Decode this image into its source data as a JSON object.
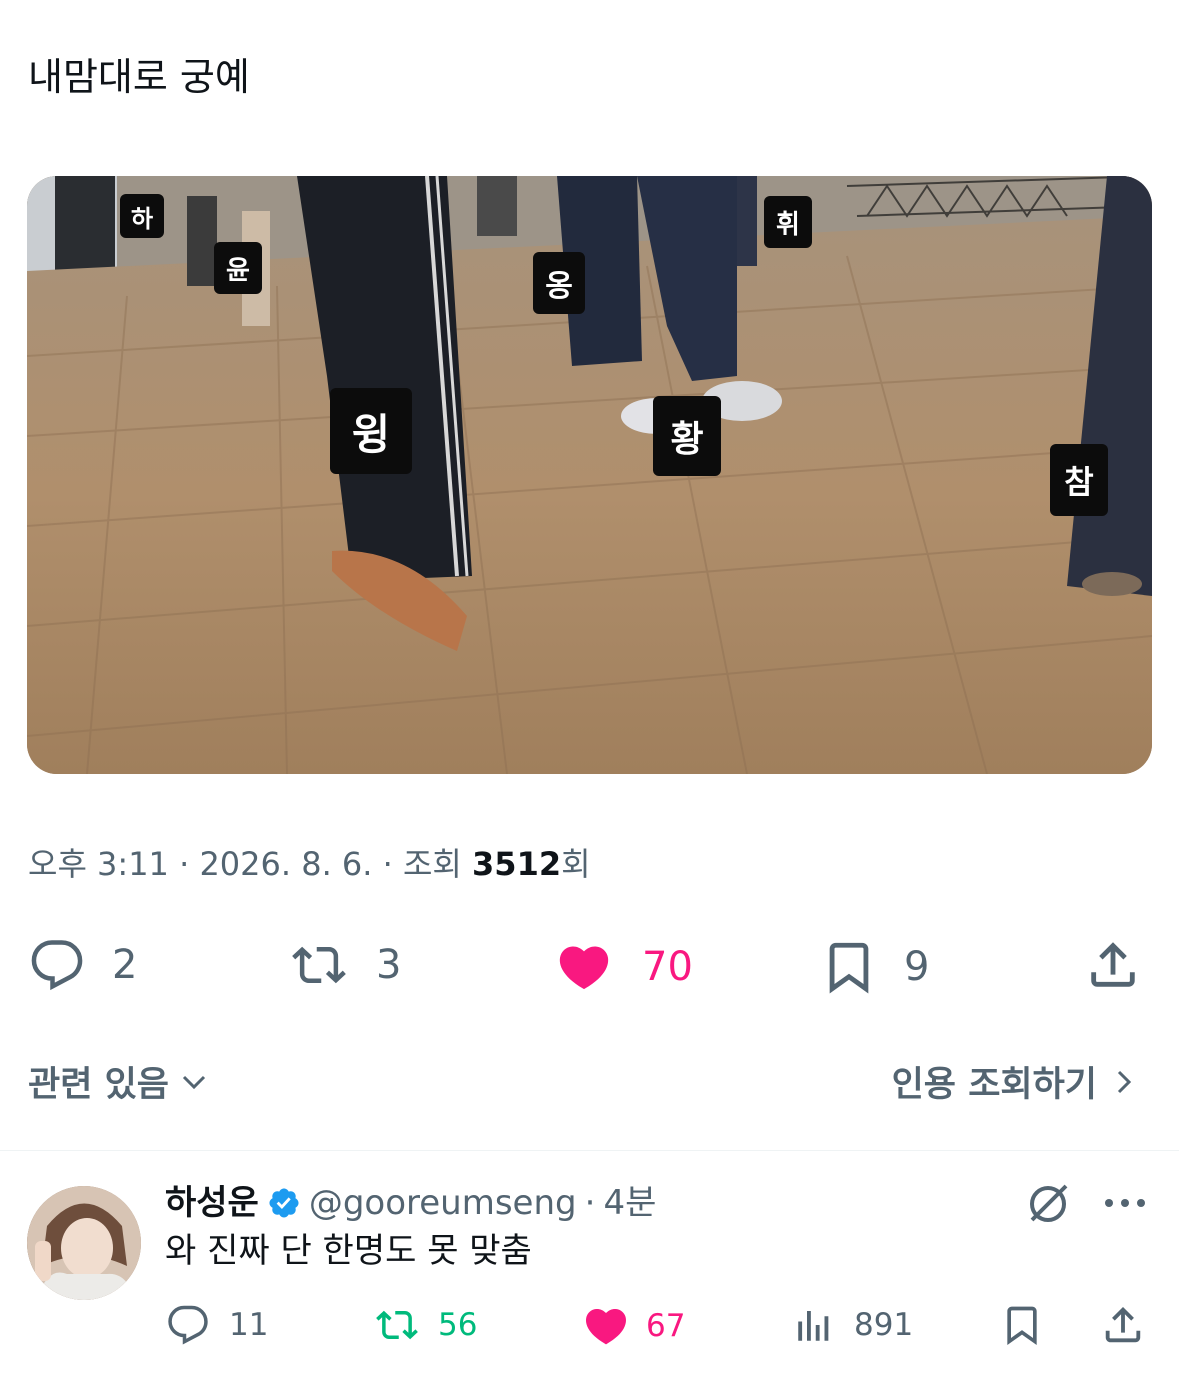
{
  "tweet": {
    "text": "내맘대로 궁예",
    "media_tags": [
      "하",
      "윤",
      "옹",
      "휘",
      "윙",
      "황",
      "참"
    ],
    "meta": {
      "time": "오후 3:11",
      "sep1": " · ",
      "date": "2026. 8. 6.",
      "sep2": " · ",
      "views_prefix": "조회 ",
      "views": "3512",
      "views_suffix": "회"
    },
    "actions": {
      "replies": "2",
      "retweets": "3",
      "likes": "70",
      "bookmarks": "9"
    },
    "colors": {
      "like": "#f91880",
      "muted": "#536471",
      "verified": "#1d9bf0",
      "retweet": "#00ba7c"
    }
  },
  "related": {
    "label": "관련 있음",
    "quotes_label": "인용 조회하기"
  },
  "reply": {
    "name": "하성운",
    "handle": "@gooreumseng",
    "sep": " · ",
    "time": "4분",
    "text": "와 진짜 단 한명도 못 맞춤",
    "actions": {
      "replies": "11",
      "retweets": "56",
      "likes": "67",
      "views": "891"
    }
  },
  "icons": [
    "reply-icon",
    "retweet-icon",
    "heart-icon",
    "bookmark-icon",
    "share-icon",
    "chevron-down-icon",
    "chevron-right-icon",
    "verified-badge-icon",
    "grok-icon",
    "more-icon",
    "views-icon"
  ]
}
